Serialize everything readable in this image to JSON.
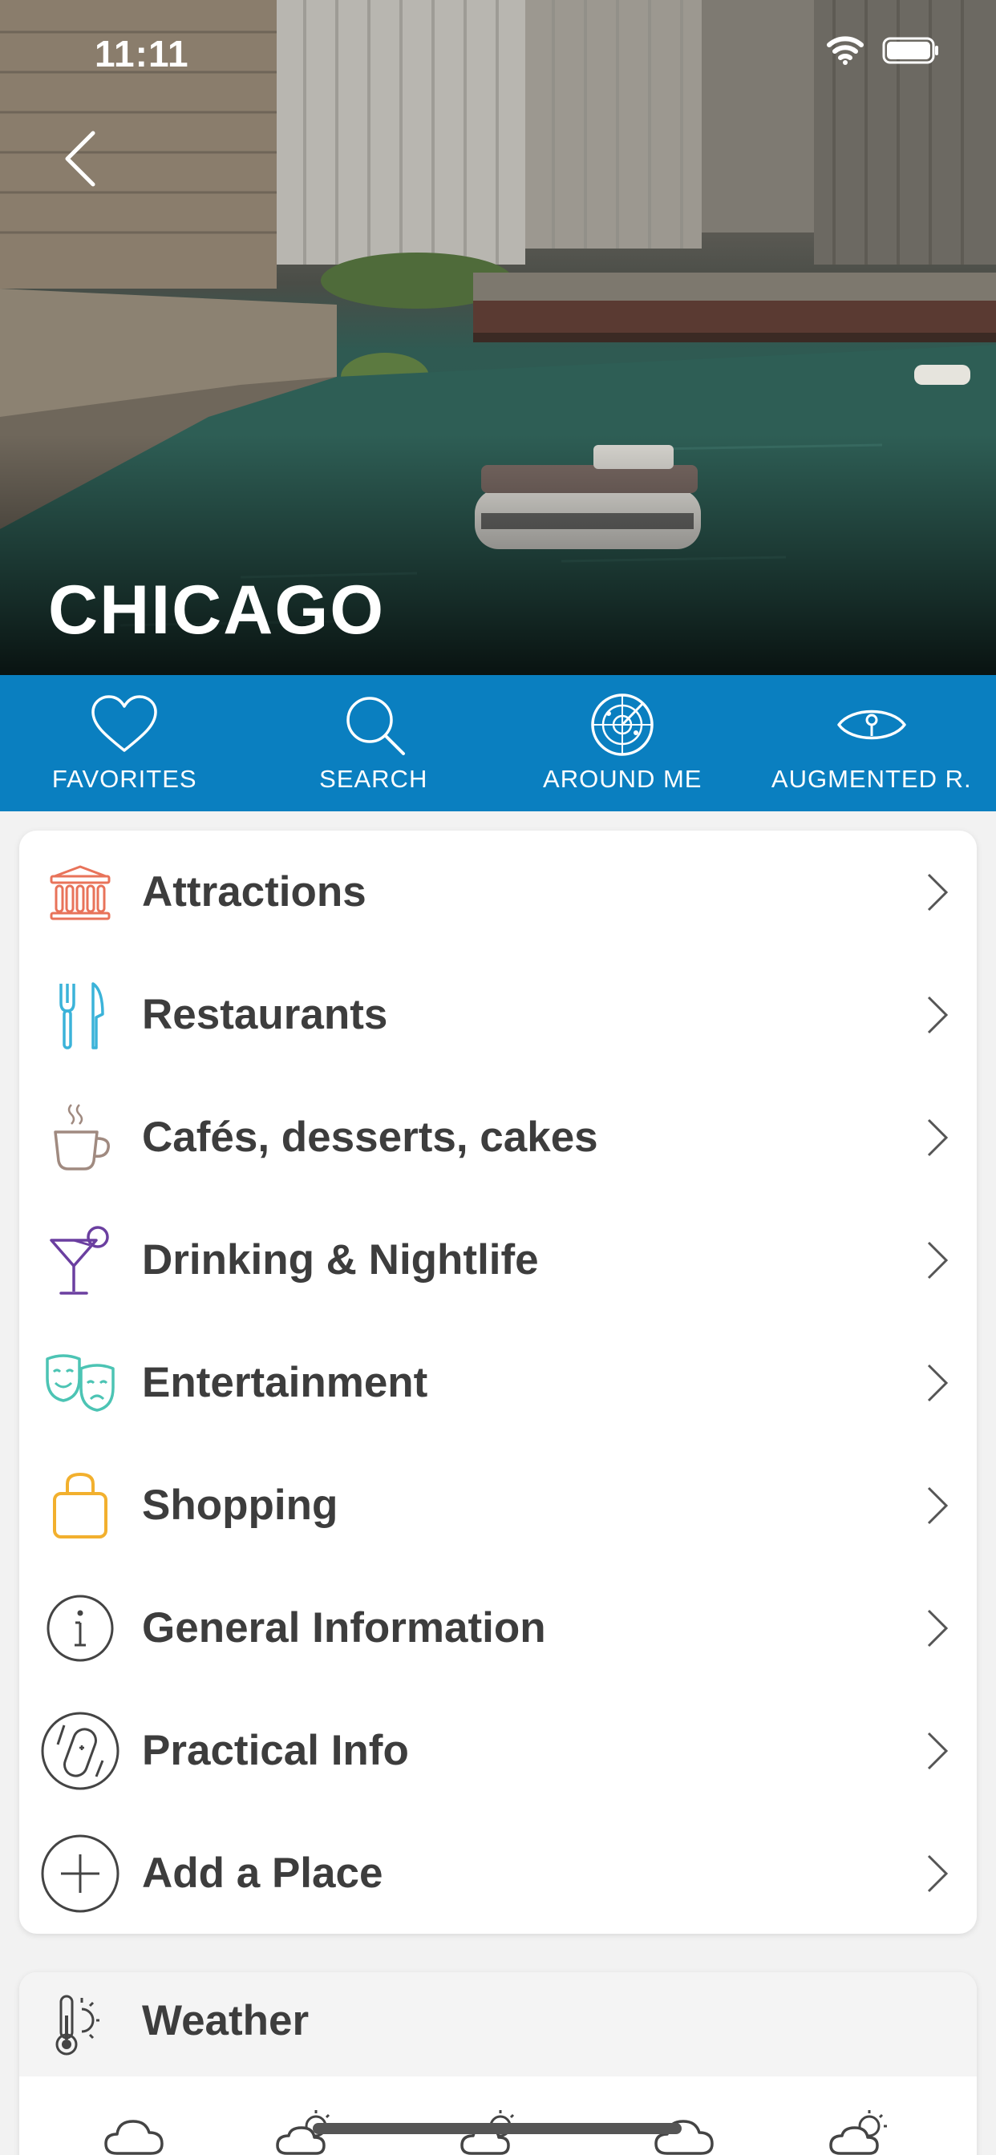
{
  "status_bar": {
    "time": "11:11",
    "icons": [
      "wifi-icon",
      "battery-icon"
    ]
  },
  "hero": {
    "title": "CHICAGO",
    "back_icon": "chevron-left-icon"
  },
  "toolbar": {
    "background": "#0a7fc0",
    "items": [
      {
        "label": "FAVORITES",
        "icon": "heart-icon"
      },
      {
        "label": "SEARCH",
        "icon": "search-icon"
      },
      {
        "label": "AROUND ME",
        "icon": "radar-icon"
      },
      {
        "label": "AUGMENTED R.",
        "icon": "eye-icon"
      }
    ]
  },
  "menu": {
    "items": [
      {
        "label": "Attractions",
        "icon": "museum-icon",
        "color": "#e8735a"
      },
      {
        "label": "Restaurants",
        "icon": "fork-knife-icon",
        "color": "#3bb3d9"
      },
      {
        "label": "Cafés, desserts, cakes",
        "icon": "coffee-cup-icon",
        "color": "#a08a80"
      },
      {
        "label": "Drinking & Nightlife",
        "icon": "cocktail-icon",
        "color": "#6b3fa0"
      },
      {
        "label": "Entertainment",
        "icon": "theater-masks-icon",
        "color": "#4cc4b4"
      },
      {
        "label": "Shopping",
        "icon": "shopping-bag-icon",
        "color": "#f2b02e"
      },
      {
        "label": "General Information",
        "icon": "info-icon",
        "color": "#444444"
      },
      {
        "label": "Practical Info",
        "icon": "swiss-knife-icon",
        "color": "#444444"
      },
      {
        "label": "Add a Place",
        "icon": "plus-circle-icon",
        "color": "#444444"
      }
    ]
  },
  "weather": {
    "title": "Weather",
    "icon": "thermometer-sun-icon",
    "forecast_icons": [
      "cloud-icon",
      "sun-rain-icon",
      "sun-rain-icon",
      "cloud-icon",
      "sun-rain-icon"
    ]
  }
}
